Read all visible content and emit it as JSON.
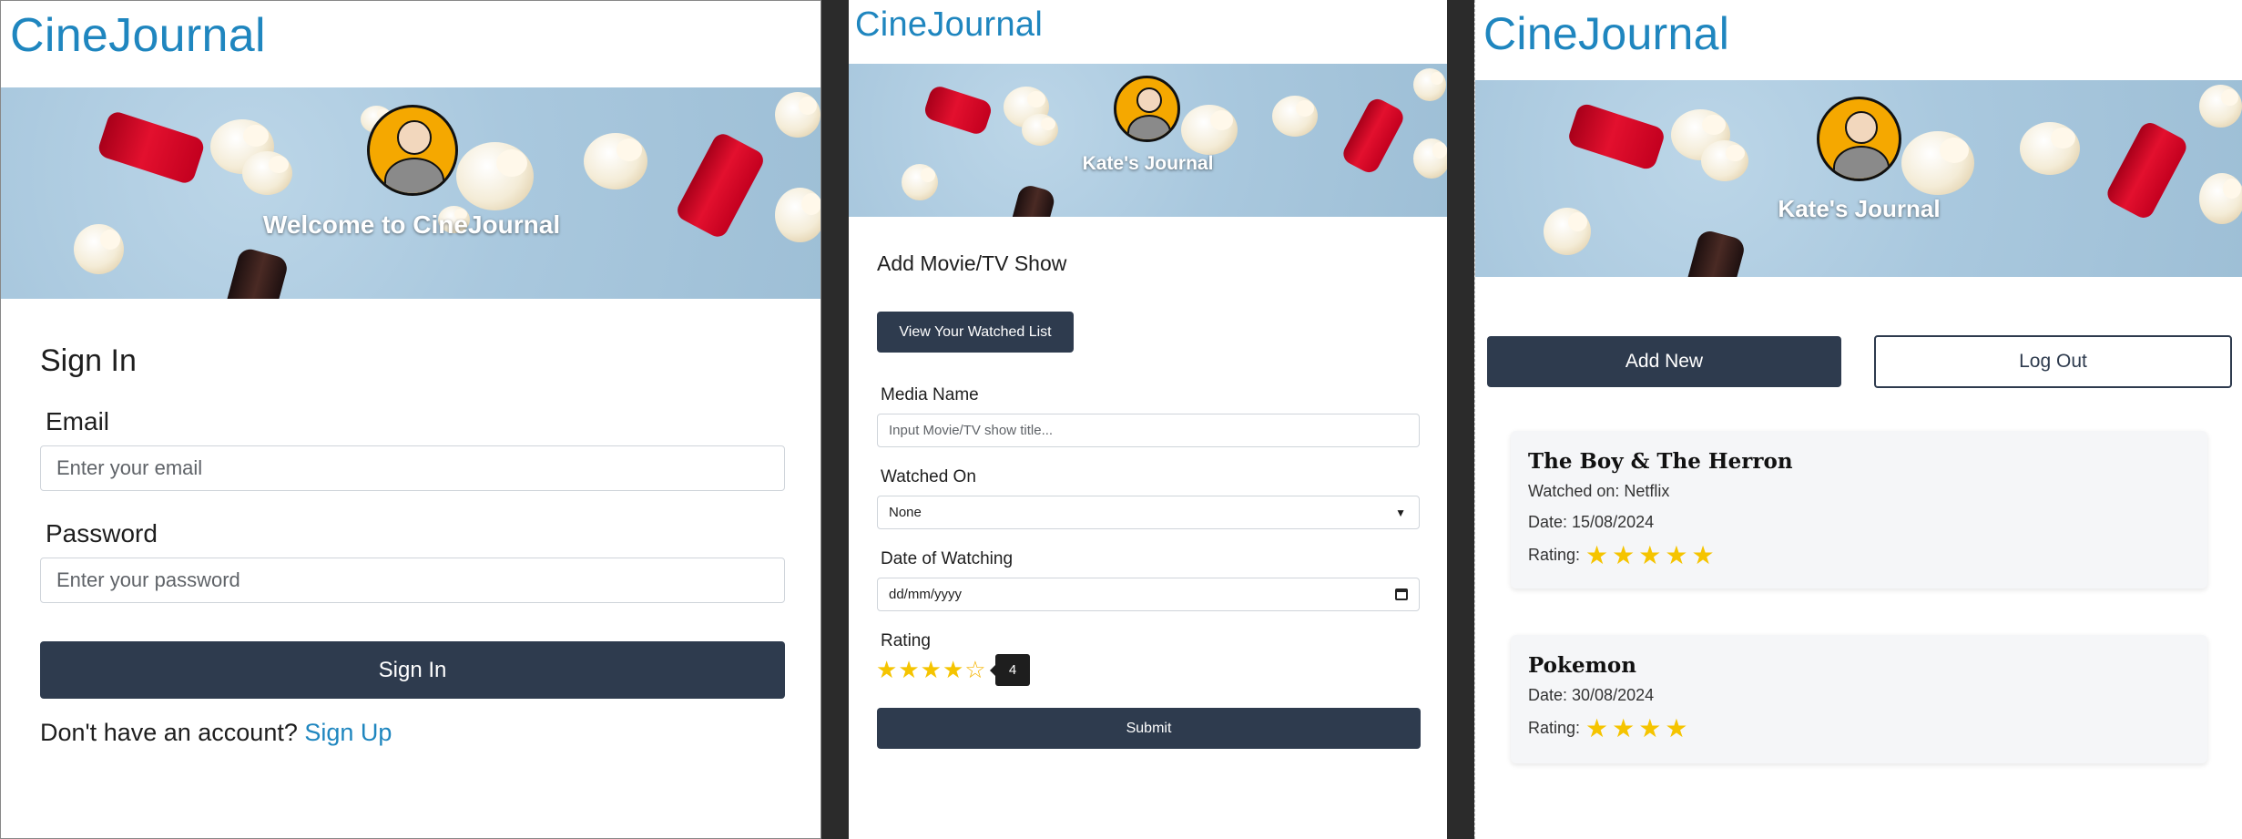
{
  "brand": "CineJournal",
  "signin_screen": {
    "hero_title": "Welcome to CineJournal",
    "heading": "Sign In",
    "email_label": "Email",
    "email_placeholder": "Enter your email",
    "password_label": "Password",
    "password_placeholder": "Enter your password",
    "signin_button": "Sign In",
    "signup_prompt": "Don't have an account?",
    "signup_link": "Sign Up"
  },
  "add_screen": {
    "hero_title": "Kate's Journal",
    "heading": "Add Movie/TV Show",
    "view_list_button": "View Your Watched List",
    "media_label": "Media Name",
    "media_placeholder": "Input Movie/TV show title...",
    "watched_on_label": "Watched On",
    "watched_on_value": "None",
    "date_label": "Date of Watching",
    "date_value": "dd/mm/yyyy",
    "rating_label": "Rating",
    "rating_value": 4,
    "rating_max": 5,
    "rating_tooltip": "4",
    "submit_button": "Submit"
  },
  "list_screen": {
    "hero_title": "Kate's Journal",
    "add_new_button": "Add New",
    "logout_button": "Log Out",
    "entries": [
      {
        "title": "The Boy & The Herron",
        "watched_on": "Watched on: Netflix",
        "date": "Date: 15/08/2024",
        "rating_label": "Rating:",
        "rating": 5
      },
      {
        "title": "Pokemon",
        "date": "Date: 30/08/2024",
        "rating_label": "Rating:",
        "rating": 4
      }
    ]
  },
  "colors": {
    "brand": "#1f86bf",
    "button_dark": "#2e3b4e",
    "star": "#f5c400",
    "avatar": "#f5a800"
  }
}
